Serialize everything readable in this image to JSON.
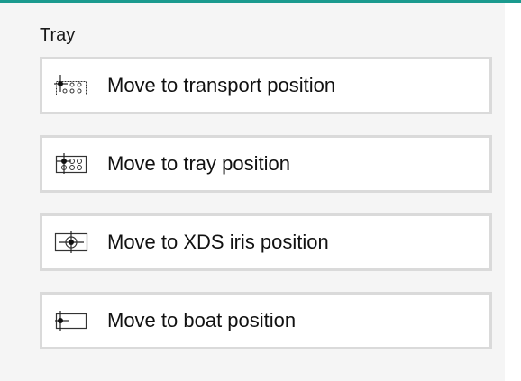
{
  "group": {
    "title": "Tray"
  },
  "buttons": [
    {
      "label": "Move to transport position",
      "icon": "transport-position-icon"
    },
    {
      "label": "Move to tray position",
      "icon": "tray-position-icon"
    },
    {
      "label": "Move to XDS iris position",
      "icon": "xds-iris-position-icon"
    },
    {
      "label": "Move to boat position",
      "icon": "boat-position-icon"
    }
  ],
  "colors": {
    "accent": "#1a9a8e",
    "panel_background": "#f5f5f5",
    "button_border": "#dadada"
  }
}
